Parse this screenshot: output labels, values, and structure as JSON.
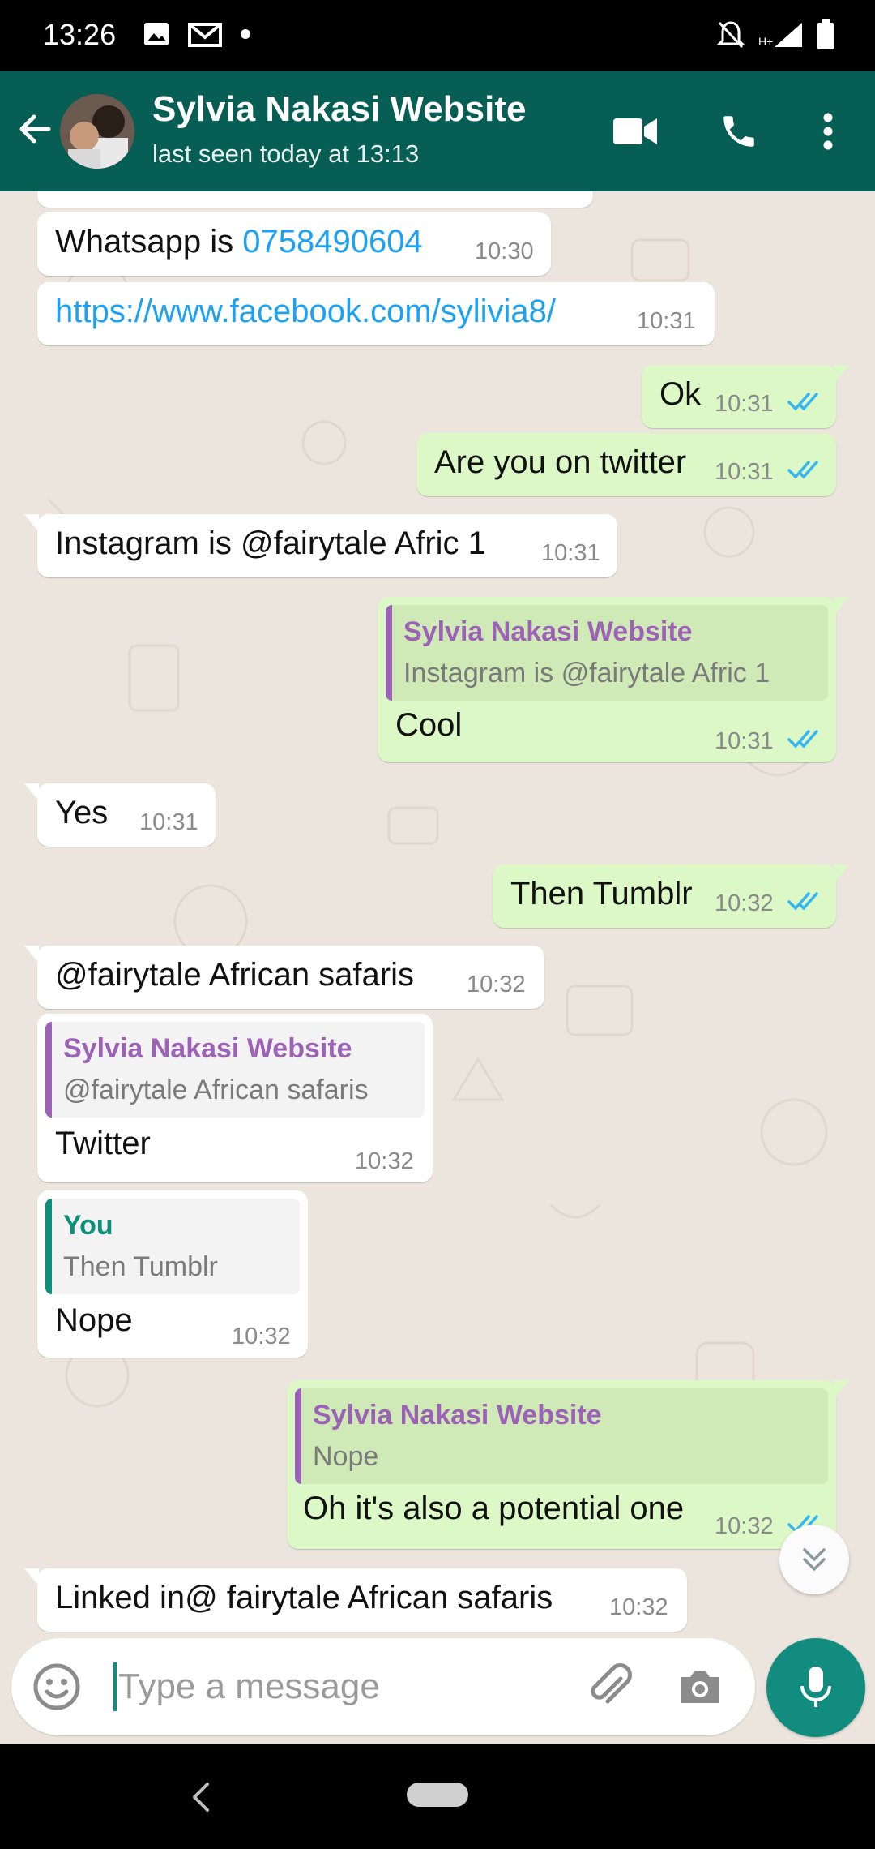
{
  "status_bar": {
    "time": "13:26",
    "icons": [
      "image-icon",
      "gmail-icon",
      "dot-icon",
      "mute-icon",
      "signal-icon",
      "battery-icon"
    ]
  },
  "header": {
    "contact_name": "Sylvia Nakasi Website",
    "last_seen": "last seen today at 13:13",
    "icons": [
      "back-arrow-icon",
      "video-call-icon",
      "phone-icon",
      "more-vert-icon"
    ]
  },
  "colors": {
    "header": "#075E54",
    "accent": "#128C7E",
    "outgoing_bubble": "#dcf8c6",
    "incoming_bubble": "#ffffff",
    "chat_bg": "#ece5dd",
    "link": "#1da1f2",
    "read_ticks": "#34b7f1",
    "quote_contact": "#9c62b6",
    "quote_you": "#0d8f7a"
  },
  "messages": [
    {
      "dir": "in",
      "text": "Whatsapp is ",
      "link": "0758490604",
      "time": "10:30"
    },
    {
      "dir": "in",
      "link": "https://www.facebook.com/sylivia8/",
      "time": "10:31"
    },
    {
      "dir": "out",
      "text": "Ok",
      "time": "10:31",
      "status": "read"
    },
    {
      "dir": "out",
      "text": "Are you on twitter",
      "time": "10:31",
      "status": "read"
    },
    {
      "dir": "in",
      "text": "Instagram is @fairytale Afric 1",
      "time": "10:31"
    },
    {
      "dir": "out",
      "quote": {
        "name": "Sylvia Nakasi Website",
        "text": "Instagram is @fairytale Afric 1"
      },
      "text": "Cool",
      "time": "10:31",
      "status": "read"
    },
    {
      "dir": "in",
      "text": "Yes",
      "time": "10:31"
    },
    {
      "dir": "out",
      "text": "Then Tumblr",
      "time": "10:32",
      "status": "read"
    },
    {
      "dir": "in",
      "text": "@fairytale African safaris",
      "time": "10:32"
    },
    {
      "dir": "in",
      "quote": {
        "name": "Sylvia Nakasi Website",
        "text": "@fairytale African safaris"
      },
      "text": "Twitter",
      "time": "10:32"
    },
    {
      "dir": "in",
      "quote": {
        "name": "You",
        "text": "Then Tumblr"
      },
      "text": "Nope",
      "time": "10:32"
    },
    {
      "dir": "out",
      "quote": {
        "name": "Sylvia Nakasi Website",
        "text": "Nope"
      },
      "text": "Oh it's also a potential one",
      "time": "10:32",
      "status": "read"
    },
    {
      "dir": "in",
      "text": "Linked in@ fairytale African safaris",
      "time": "10:32"
    }
  ],
  "composer": {
    "placeholder": "Type a message",
    "icons": [
      "emoji-icon",
      "attach-icon",
      "camera-icon",
      "mic-icon"
    ]
  },
  "scroll_button_icon": "double-chevron-down-icon",
  "nav_bar": {
    "icons": [
      "nav-back-icon",
      "nav-home-pill"
    ]
  }
}
